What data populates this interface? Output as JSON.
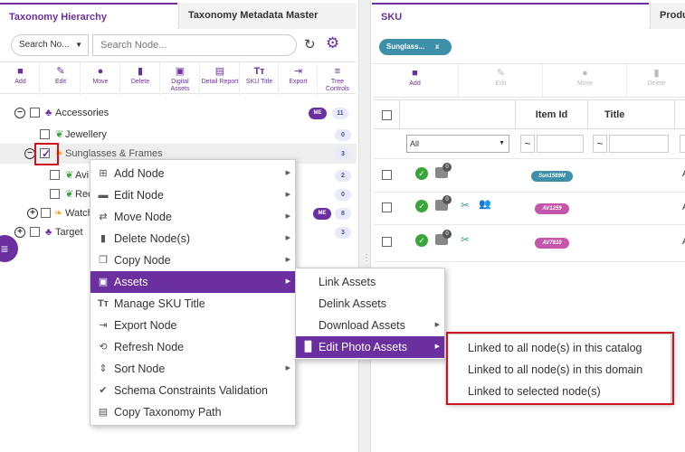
{
  "left_panel": {
    "tabs": [
      {
        "label": "Taxonomy Hierarchy",
        "active": true
      },
      {
        "label": "Taxonomy Metadata Master",
        "active": false
      }
    ],
    "search": {
      "select_value": "Search No...",
      "placeholder": "Search Node..."
    },
    "toolbar": [
      {
        "icon": "add-folder-icon",
        "label": "Add"
      },
      {
        "icon": "edit-icon",
        "label": "Edit"
      },
      {
        "icon": "move-icon",
        "label": "Move"
      },
      {
        "icon": "delete-icon",
        "label": "Delete"
      },
      {
        "icon": "digital-assets-icon",
        "label": "Digital Assets"
      },
      {
        "icon": "detail-report-icon",
        "label": "Detail Report"
      },
      {
        "icon": "sku-title-icon",
        "label": "SKU Title"
      },
      {
        "icon": "export-icon",
        "label": "Export"
      },
      {
        "icon": "tree-controls-icon",
        "label": "Tree Controls"
      }
    ],
    "tree": [
      {
        "label": "Accessories",
        "me": "ME",
        "count": "11"
      },
      {
        "label": "Jewellery",
        "count": "0"
      },
      {
        "label": "Sunglasses & Frames",
        "count": "3"
      },
      {
        "label": "Avi",
        "count": "2"
      },
      {
        "label": "Rec",
        "count": "0"
      },
      {
        "label": "Watch",
        "me": "ME",
        "count": "8"
      },
      {
        "label": "Target",
        "count": "3"
      }
    ]
  },
  "context_menu": {
    "items": [
      {
        "icon": "add-node-icon",
        "label": "Add Node",
        "submenu": true
      },
      {
        "icon": "folder-icon",
        "label": "Edit Node",
        "submenu": true
      },
      {
        "icon": "move-icon",
        "label": "Move Node",
        "submenu": true
      },
      {
        "icon": "trash-icon",
        "label": "Delete Node(s)",
        "submenu": true
      },
      {
        "icon": "copy-icon",
        "label": "Copy Node",
        "submenu": true
      },
      {
        "icon": "image-icon",
        "label": "Assets",
        "submenu": true,
        "highlighted": true
      },
      {
        "icon": "text-icon",
        "label": "Manage SKU Title",
        "submenu": false
      },
      {
        "icon": "export-icon",
        "label": "Export Node",
        "submenu": false
      },
      {
        "icon": "refresh-icon",
        "label": "Refresh Node",
        "submenu": false
      },
      {
        "icon": "sort-icon",
        "label": "Sort Node",
        "submenu": true
      },
      {
        "icon": "check-circle-icon",
        "label": "Schema Constraints Validation",
        "submenu": false
      },
      {
        "icon": "clipboard-icon",
        "label": "Copy Taxonomy Path",
        "submenu": false
      }
    ]
  },
  "assets_menu": {
    "items": [
      {
        "label": "Link Assets",
        "submenu": false
      },
      {
        "label": "Delink Assets",
        "submenu": false
      },
      {
        "label": "Download Assets",
        "submenu": true
      },
      {
        "label": "Edit Photo Assets",
        "submenu": true,
        "highlighted": true
      }
    ]
  },
  "edit_photo_menu": {
    "items": [
      {
        "label": "Linked to all node(s) in this catalog"
      },
      {
        "label": "Linked to all node(s) in this domain"
      },
      {
        "label": "Linked to selected node(s)"
      }
    ]
  },
  "right_panel": {
    "tabs": [
      {
        "label": "SKU",
        "active": true
      },
      {
        "label": "Produ",
        "active": false
      }
    ],
    "chip": {
      "label": "Sunglass...",
      "close": "x"
    },
    "toolbar": [
      {
        "icon": "add-folder-icon",
        "label": "Add"
      },
      {
        "icon": "edit-icon",
        "label": "Edit"
      },
      {
        "icon": "move-icon",
        "label": "Move"
      },
      {
        "icon": "delete-icon",
        "label": "Delete"
      }
    ],
    "grid": {
      "columns": [
        "Item Id",
        "Title"
      ],
      "filter": {
        "select_value": "All",
        "tilde": "~"
      },
      "rows": [
        {
          "item_id": "Sun1589M",
          "color": "#3e8fa8",
          "badge": "0",
          "extra": "A"
        },
        {
          "item_id": "AV1259",
          "color": "#c455a8",
          "badge": "0",
          "extra": "A"
        },
        {
          "item_id": "AV7810",
          "color": "#c455a8",
          "badge": "0",
          "extra": "A"
        }
      ]
    }
  },
  "colors": {
    "accent": "#6b2fa0",
    "highlight_border": "#d0121b",
    "teal": "#3e8fa8"
  }
}
